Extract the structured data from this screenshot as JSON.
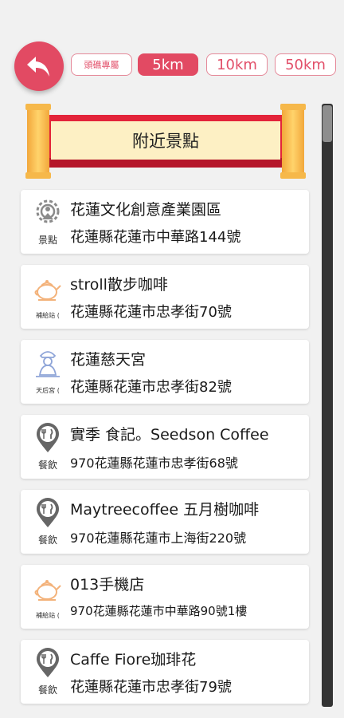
{
  "toolbar": {
    "back_icon": "back-arrow-icon",
    "filters": [
      {
        "label": "頭礁專屬",
        "active": false
      },
      {
        "label": "5km",
        "active": true
      },
      {
        "label": "10km",
        "active": false
      },
      {
        "label": "50km",
        "active": false
      }
    ]
  },
  "banner": {
    "title": "附近景點"
  },
  "colors": {
    "accent": "#e24a63",
    "banner_red": "#e3243a",
    "banner_gold": "#f2a73b",
    "icon_peach": "#f3b27a",
    "icon_blue": "#8fa5d8"
  },
  "places": [
    {
      "name": "花蓮文化創意產業園區",
      "address": "花蓮縣花蓮市中華路144號",
      "category": "景點",
      "icon": "gear-landmark-icon"
    },
    {
      "name": "stroll散步咖啡",
      "address": "花蓮縣花蓮市忠孝街70號",
      "category": "補給站 (",
      "icon": "teapot-icon"
    },
    {
      "name": "花蓮慈天宮",
      "address": "花蓮縣花蓮市忠孝街82號",
      "category": "天后宮 (",
      "icon": "temple-deity-icon"
    },
    {
      "name": "實季 食記。Seedson Coffee",
      "address": "970花蓮縣花蓮市忠孝街68號",
      "category": "餐飲",
      "icon": "restaurant-pin-icon"
    },
    {
      "name": "Maytreecoffee 五月樹咖啡",
      "address": "970花蓮縣花蓮市上海街220號",
      "category": "餐飲",
      "icon": "restaurant-pin-icon"
    },
    {
      "name": "013手機店",
      "address": "970花蓮縣花蓮市中華路90號1樓",
      "category": "補給站 (",
      "icon": "teapot-icon"
    },
    {
      "name": "Caffe Fiore珈琲花",
      "address": "花蓮縣花蓮市忠孝街79號",
      "category": "餐飲",
      "icon": "restaurant-pin-icon"
    }
  ]
}
